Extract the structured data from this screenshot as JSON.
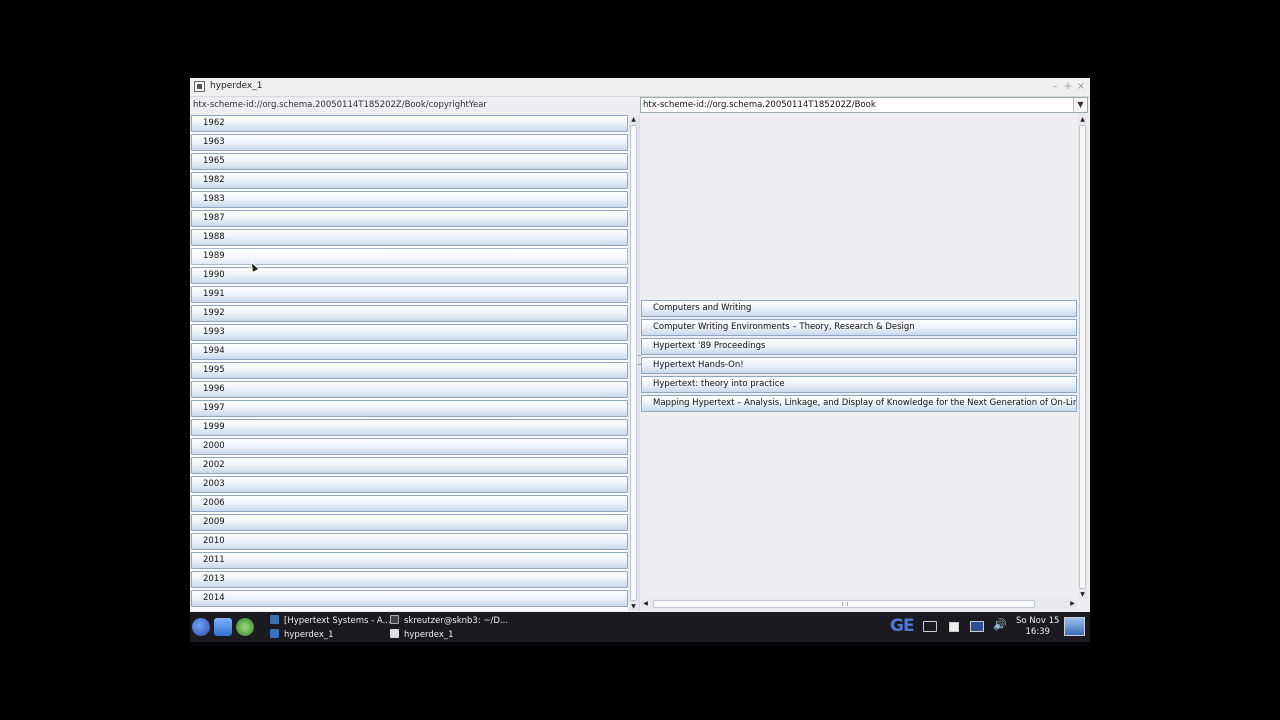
{
  "window": {
    "title": "hyperdex_1",
    "minimize": "–",
    "maximize": "+",
    "close": "×"
  },
  "left_path": "htx-scheme-id://org.schema.20050114T185202Z/Book/copyrightYear",
  "scheme_select": {
    "value": "htx-scheme-id://org.schema.20050114T185202Z/Book",
    "arrow": "▼"
  },
  "years": [
    "1962",
    "1963",
    "1965",
    "1982",
    "1983",
    "1987",
    "1988",
    "1989",
    "1990",
    "1991",
    "1992",
    "1993",
    "1994",
    "1995",
    "1996",
    "1997",
    "1999",
    "2000",
    "2002",
    "2003",
    "2006",
    "2009",
    "2010",
    "2011",
    "2013",
    "2014"
  ],
  "books": [
    "Computers and Writing",
    "Computer Writing Environments – Theory, Research & Design",
    "Hypertext '89 Proceedings",
    "Hypertext Hands-On!",
    "Hypertext: theory into practice",
    "Mapping Hypertext – Analysis, Linkage, and Display of Knowledge for the Next Generation of On-Line Text and Graphics"
  ],
  "taskbar": {
    "tasks": [
      {
        "label": "[Hypertext Systems - A..."
      },
      {
        "label": "skreutzer@sknb3: ~/D..."
      },
      {
        "label": "hyperdex_1"
      },
      {
        "label": "hyperdex_1"
      }
    ],
    "ge": "GE",
    "clock_day": "So Nov 15",
    "clock_time": "16:39",
    "volume": "🔊"
  },
  "icons": {
    "start": "start-menu-icon",
    "home": "home-folder-icon",
    "browser": "browser-icon",
    "battery": "battery-icon",
    "network": "network-icon"
  }
}
